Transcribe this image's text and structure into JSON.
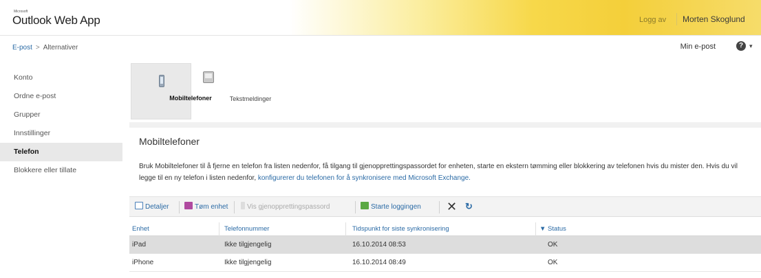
{
  "header": {
    "brand_small": "Microsoft",
    "app_title": "Outlook Web App",
    "logout": "Logg av",
    "user_name": "Morten Skoglund"
  },
  "breadcrumb": {
    "root": "E-post",
    "separator": ">",
    "current": "Alternativer"
  },
  "top_right": {
    "my_mail": "Min e-post",
    "help": "?",
    "menu_arrow": "▾"
  },
  "sidebar": {
    "items": [
      {
        "label": "Konto"
      },
      {
        "label": "Ordne e-post"
      },
      {
        "label": "Grupper"
      },
      {
        "label": "Innstillinger"
      },
      {
        "label": "Telefon",
        "active": true
      },
      {
        "label": "Blokkere eller tillate"
      }
    ]
  },
  "tabs": [
    {
      "label": "Mobiltelefoner",
      "icon": "mobile-phone-icon",
      "active": true
    },
    {
      "label": "Tekstmeldinger",
      "icon": "text-message-icon",
      "active": false
    }
  ],
  "panel": {
    "title": "Mobiltelefoner",
    "description": "Bruk Mobiltelefoner til å fjerne en telefon fra listen nedenfor, få tilgang til gjenopprettingspassordet for enheten, starte en ekstern tømming eller blokkering av telefonen hvis du mister den. Hvis du vil legge til en ny telefon i listen nedenfor,",
    "link": "konfigurerer du telefonen for å synkronisere med Microsoft Exchange."
  },
  "toolbar": {
    "details": "Detaljer",
    "wipe": "Tøm enhet",
    "recovery": "Vis gjenopprettingspassord",
    "logging": "Starte loggingen",
    "delete": "✕",
    "refresh": "↻"
  },
  "table": {
    "columns": [
      "Enhet",
      "Telefonnummer",
      "Tidspunkt for siste synkronisering",
      "Status"
    ],
    "rows": [
      {
        "device": "iPad",
        "phone": "Ikke tilgjengelig",
        "last_sync": "16.10.2014 08:53",
        "status": "OK",
        "selected": true
      },
      {
        "device": "iPhone",
        "phone": "Ikke tilgjengelig",
        "last_sync": "16.10.2014 08:49",
        "status": "OK",
        "selected": false
      }
    ]
  },
  "colors": {
    "link": "#2a6aa5",
    "header_gold": "#f4cf3a",
    "selected_row": "#dddddd"
  }
}
